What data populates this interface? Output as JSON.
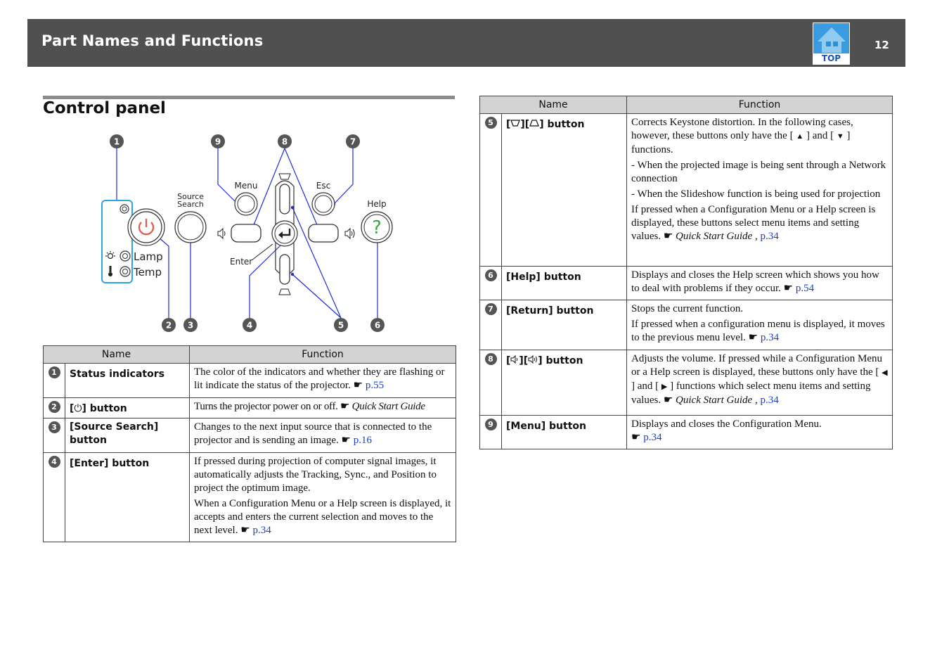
{
  "header": {
    "title": "Part Names and Functions",
    "top_label": "TOP",
    "page_number": "12"
  },
  "section": {
    "title": "Control panel"
  },
  "diagram": {
    "callouts": [
      "1",
      "9",
      "8",
      "7",
      "2",
      "3",
      "4",
      "5",
      "6"
    ],
    "labels": {
      "source": "Source",
      "search": "Search",
      "menu": "Menu",
      "esc": "Esc",
      "help": "Help",
      "lamp": "Lamp",
      "temp": "Temp",
      "enter": "Enter",
      "help_glyph": "?"
    }
  },
  "tables": {
    "head_name": "Name",
    "head_function": "Function",
    "hand": "☛",
    "left": [
      {
        "num": "1",
        "name": "Status indicators",
        "text": "The color of the indicators and whether they are flashing or lit indicate the status of the projector.",
        "link": "p.55"
      },
      {
        "num": "2",
        "name_pre": "[",
        "name_icon": "⏻",
        "name_post": "] button",
        "text": "Turns the projector power on or off.",
        "italic": "Quick Start Guide"
      },
      {
        "num": "3",
        "name": "[Source Search] button",
        "text": "Changes to the next input source that is connected to the projector and is sending an image.",
        "link": "p.16"
      },
      {
        "num": "4",
        "name": "[Enter] button",
        "p1": "If pressed during projection of computer signal images, it automatically adjusts the Tracking, Sync., and Position to project the optimum image.",
        "p2": "When a Configuration Menu or a Help screen is displayed, it accepts and enters the current selection and moves to the next level.",
        "link": "p.34"
      }
    ],
    "right": [
      {
        "num": "5",
        "name_post": "] button",
        "p1a": "Corrects Keystone distortion. In the following cases, however, these buttons only have the [",
        "p1b": "] and [",
        "p1c": "] functions.",
        "p2": "- When the projected image is being sent through a Network connection",
        "p3": "- When the Slideshow function is being used for projection",
        "p4": "If pressed when a Configuration Menu or a Help screen is displayed, these buttons select menu items and setting values.",
        "italic": "Quick Start Guide",
        "sep": ",",
        "link": "p.34"
      },
      {
        "num": "6",
        "name": "[Help] button",
        "text": "Displays and closes the Help screen which shows you how to deal with problems if they occur.",
        "link": "p.54"
      },
      {
        "num": "7",
        "name": "[Return] button",
        "p1": "Stops the current function.",
        "p2": "If pressed when a configuration menu is displayed, it moves to the previous menu level.",
        "link": "p.34"
      },
      {
        "num": "8",
        "name_post": "] button",
        "p1": "Adjusts the volume. If pressed while a Configuration Menu or a Help screen is displayed, these buttons only have the [",
        "p1b": "] and [",
        "p1c": "] functions which select menu items and setting values.",
        "italic": "Quick Start Guide",
        "sep": ",",
        "link": "p.34"
      },
      {
        "num": "9",
        "name": "[Menu] button",
        "text": "Displays and closes the Configuration Menu.",
        "link": "p.34"
      }
    ]
  }
}
